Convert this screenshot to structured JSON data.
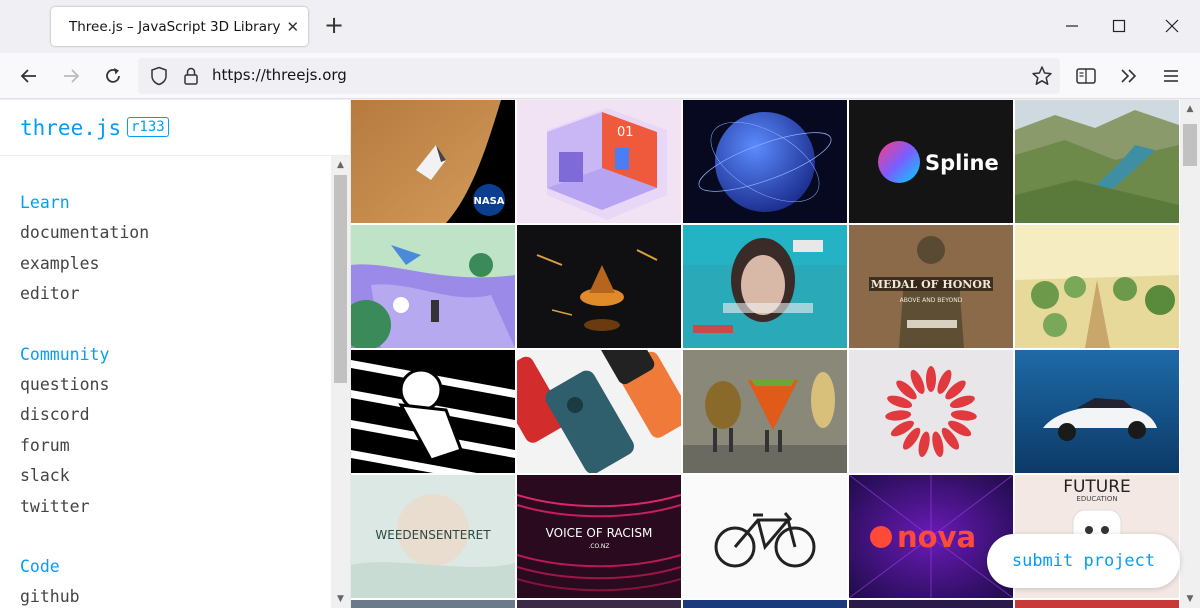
{
  "browser": {
    "tab_title": "Three.js – JavaScript 3D Library",
    "url": "https://threejs.org",
    "close_glyph": "✕",
    "newtab_glyph": "+"
  },
  "site": {
    "logo": "three.js",
    "revision": "r133",
    "submit_label": "submit project"
  },
  "sidebar": {
    "sections": [
      {
        "heading": "Learn",
        "links": [
          "documentation",
          "examples",
          "editor"
        ]
      },
      {
        "heading": "Community",
        "links": [
          "questions",
          "discord",
          "forum",
          "slack",
          "twitter"
        ]
      },
      {
        "heading": "Code",
        "links": [
          "github"
        ]
      }
    ]
  },
  "gallery": {
    "tiles": [
      {
        "name": "tile-nasa",
        "label": "NASA"
      },
      {
        "name": "tile-isometric-room",
        "label": "01"
      },
      {
        "name": "tile-globe",
        "label": ""
      },
      {
        "name": "tile-spline",
        "label": "Spline"
      },
      {
        "name": "tile-landscape",
        "label": ""
      },
      {
        "name": "tile-playground",
        "label": ""
      },
      {
        "name": "tile-spinning-top",
        "label": ""
      },
      {
        "name": "tile-glitch-portrait",
        "label": ""
      },
      {
        "name": "tile-medal-of-honor",
        "label": "MEDAL OF HONOR",
        "sub": "ABOVE AND BEYOND"
      },
      {
        "name": "tile-vineyard",
        "label": ""
      },
      {
        "name": "tile-astronaut",
        "label": ""
      },
      {
        "name": "tile-phones",
        "label": ""
      },
      {
        "name": "tile-dancing-food",
        "label": ""
      },
      {
        "name": "tile-red-flower-logo",
        "label": ""
      },
      {
        "name": "tile-car",
        "label": ""
      },
      {
        "name": "tile-weedensenteret",
        "label": "WEEDENSENTERET"
      },
      {
        "name": "tile-voice-of-racism",
        "label": "VOICE OF RACISM",
        "sub": ".CO.NZ"
      },
      {
        "name": "tile-bicycle",
        "label": ""
      },
      {
        "name": "tile-nova",
        "label": "nova"
      },
      {
        "name": "tile-future-education",
        "label": "FUTURE",
        "sub": "EDUCATION"
      }
    ]
  }
}
